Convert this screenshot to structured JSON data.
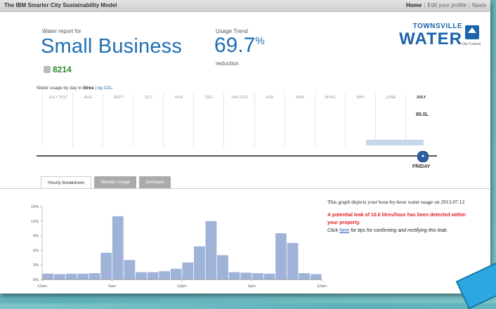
{
  "app": {
    "title": "The IBM Smarter City Sustainability Model",
    "nav": [
      "Home",
      "Edit your profile",
      "Navis"
    ]
  },
  "report": {
    "label": "Water report for",
    "name": "Small Business",
    "account": "8214"
  },
  "trend": {
    "label": "Usage Trend",
    "value": "69.7",
    "unit": "%",
    "sub": "reduction"
  },
  "logo": {
    "line1": "TOWNSVILLE",
    "line2": "WATER",
    "tiny": "City Council"
  },
  "usage": {
    "label": "Water usage by day in",
    "unit_selected": "litres",
    "unit_alt": "kg CO₂"
  },
  "timeline": {
    "months": [
      {
        "label": "JULY 2012",
        "active": false
      },
      {
        "label": "AUG",
        "active": false
      },
      {
        "label": "SEPT",
        "active": false
      },
      {
        "label": "OCT",
        "active": false
      },
      {
        "label": "NOV",
        "active": false
      },
      {
        "label": "DEC",
        "active": false
      },
      {
        "label": "JAN 2013",
        "active": false
      },
      {
        "label": "FEB",
        "active": false
      },
      {
        "label": "MAR",
        "active": false
      },
      {
        "label": "APRIL",
        "active": false
      },
      {
        "label": "MAY",
        "active": false
      },
      {
        "label": "JUNE",
        "active": false
      },
      {
        "label": "JULY",
        "active": true
      }
    ],
    "reading": "85.0L",
    "marker": "●",
    "day": "FRIDAY"
  },
  "tabs": [
    "Hourly breakdown",
    "Weekly Usage",
    "Compare"
  ],
  "description": {
    "text": "This graph depicts your hour-by-hour water usage on 2013.07.12",
    "warning": "A potential leak of 10.0 litres/hour has been detected within your property.",
    "help_pre": "Click ",
    "help_link": "here",
    "help_post": " for tips for confirming and rectifying this leak."
  },
  "chart_data": {
    "type": "bar",
    "categories": [
      "12am",
      "1am",
      "2am",
      "3am",
      "4am",
      "5am",
      "6am",
      "7am",
      "8am",
      "9am",
      "10am",
      "11am",
      "12pm",
      "1pm",
      "2pm",
      "3pm",
      "4pm",
      "5pm",
      "6pm",
      "7pm",
      "8pm",
      "9pm",
      "10pm",
      "11pm"
    ],
    "values": [
      1.2,
      1.1,
      1.2,
      1.2,
      1.3,
      5.5,
      13.0,
      4.0,
      1.5,
      1.5,
      1.7,
      2.2,
      3.5,
      6.8,
      12.0,
      5.0,
      1.5,
      1.4,
      1.3,
      1.2,
      9.5,
      7.5,
      1.3,
      1.1
    ],
    "yticks": [
      "0%",
      "3%",
      "6%",
      "9%",
      "12%",
      "15%"
    ],
    "xticks": [
      "12am",
      "6am",
      "12pm",
      "6pm",
      "12am"
    ],
    "ylim": [
      0,
      15
    ],
    "color": "#9fb3d9"
  }
}
